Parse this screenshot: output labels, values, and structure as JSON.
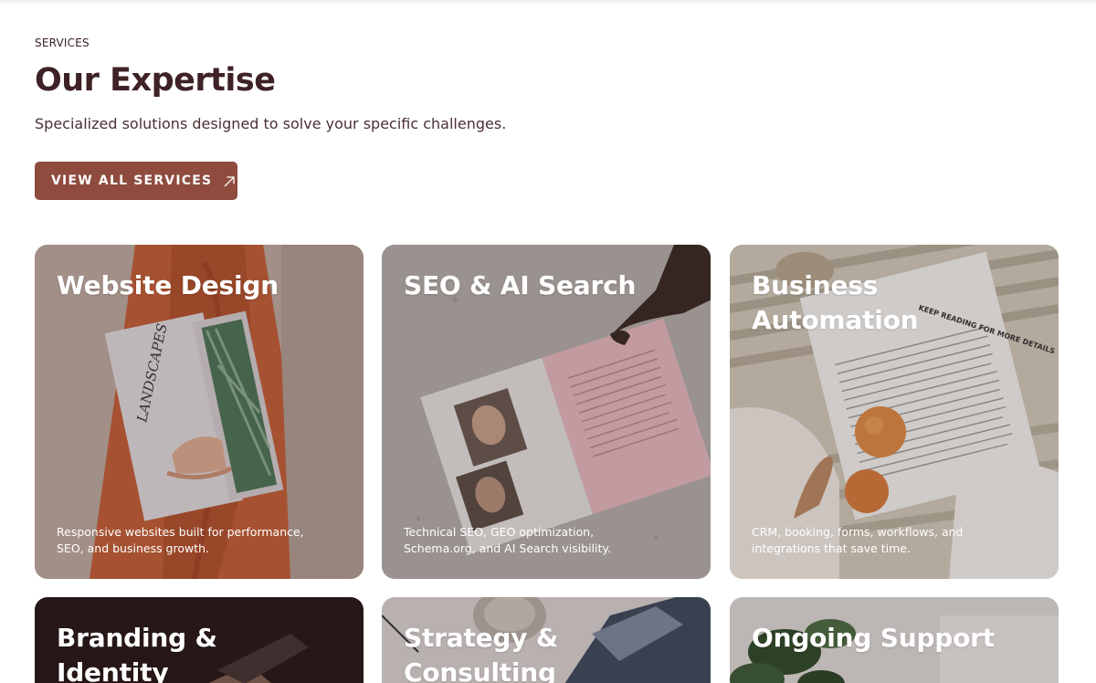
{
  "section": {
    "eyebrow": "SERVICES",
    "title": "Our Expertise",
    "subtitle": "Specialized solutions designed to solve your specific challenges.",
    "cta_label": "VIEW ALL SERVICES",
    "cta_icon": "arrow-up-right-icon"
  },
  "colors": {
    "heading": "#3e2225",
    "cta_background": "#8e4b3e",
    "card_text": "#ffffff"
  },
  "cards": [
    {
      "title": "Website Design",
      "description": "Responsive websites built for performance, SEO, and business growth.",
      "book_text": "LANDSCAPES"
    },
    {
      "title": "SEO & AI Search",
      "description": "Technical SEO, GEO optimization, Schema.org, and AI Search visibility."
    },
    {
      "title": "Business Automation",
      "description": "CRM, booking, forms, workflows, and integrations that save time.",
      "magazine_text": "KEEP READING FOR MORE DETAILS"
    },
    {
      "title": "Branding & Identity"
    },
    {
      "title": "Strategy & Consulting"
    },
    {
      "title": "Ongoing Support"
    }
  ]
}
